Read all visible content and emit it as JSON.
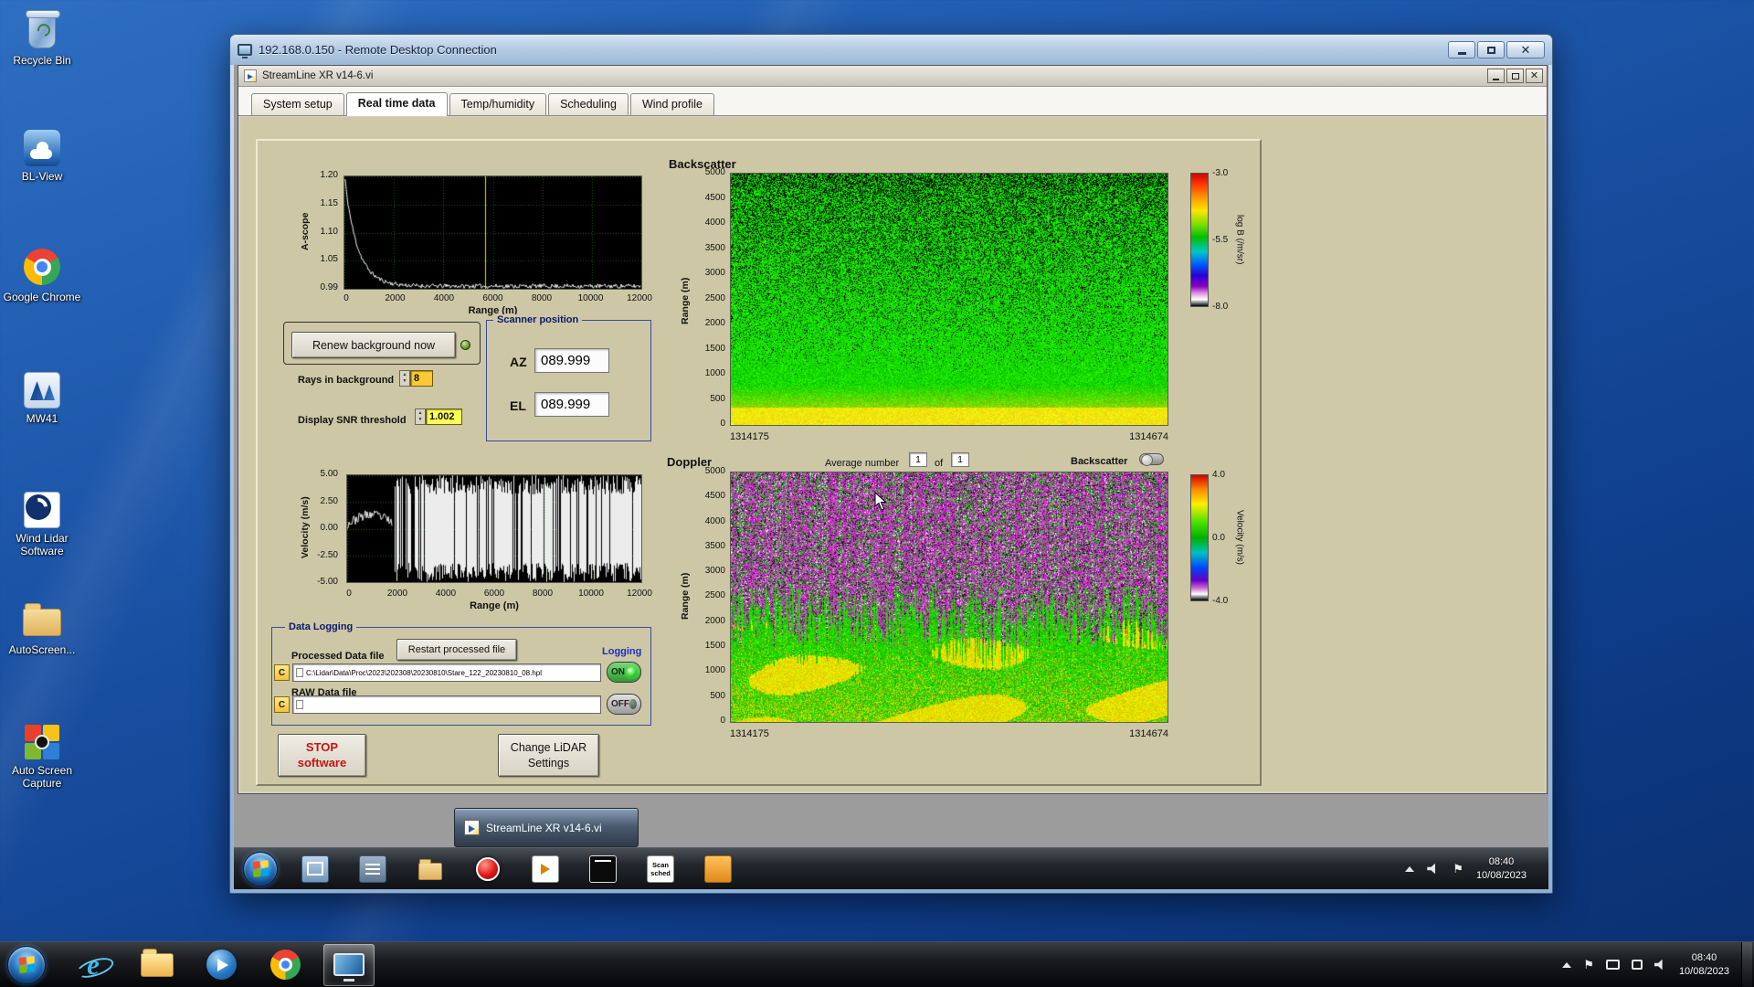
{
  "desktop": {
    "icons": [
      {
        "label": "Recycle Bin"
      },
      {
        "label": "BL-View"
      },
      {
        "label": "Google Chrome"
      },
      {
        "label": "MW41"
      },
      {
        "label": "Wind Lidar Software"
      },
      {
        "label": "AutoScreen..."
      },
      {
        "label": "Auto Screen Capture"
      }
    ]
  },
  "rdp": {
    "title": "192.168.0.150 - Remote Desktop Connection"
  },
  "app": {
    "title": "StreamLine XR v14-6.vi",
    "tabs": [
      "System setup",
      "Real time data",
      "Temp/humidity",
      "Scheduling",
      "Wind profile"
    ],
    "active_tab": "Real time data"
  },
  "ascope": {
    "ylabel": "A-scope",
    "xlabel": "Range (m)",
    "yticks": [
      "1.20",
      "1.15",
      "1.10",
      "1.05",
      "0.99"
    ],
    "xticks": [
      "0",
      "2000",
      "4000",
      "6000",
      "8000",
      "10000",
      "12000"
    ]
  },
  "background_controls": {
    "renew_button": "Renew background now",
    "rays_label": "Rays in background",
    "rays_value": "8",
    "snr_label": "Display SNR threshold",
    "snr_value": "1.002"
  },
  "scanner": {
    "title": "Scanner position",
    "az_label": "AZ",
    "az_value": "089.999",
    "el_label": "EL",
    "el_value": "089.999"
  },
  "backscatter": {
    "title": "Backscatter",
    "ylabel": "Range (m)",
    "yticks": [
      "5000",
      "4500",
      "4000",
      "3500",
      "3000",
      "2500",
      "2000",
      "1500",
      "1000",
      "500",
      "0"
    ],
    "x_start": "1314175",
    "x_end": "1314674",
    "colorbar_ticks": [
      "-3.0",
      "-5.5",
      "-8.0"
    ],
    "colorbar_label": "log B (/m/sr)"
  },
  "doppler": {
    "title": "Doppler",
    "avg_label": "Average number",
    "avg_value": "1",
    "of_label": "of",
    "of_value": "1",
    "toggle_label": "Backscatter",
    "ylabel": "Range (m)",
    "yticks": [
      "5000",
      "4500",
      "4000",
      "3500",
      "3000",
      "2500",
      "2000",
      "1500",
      "1000",
      "500",
      "0"
    ],
    "x_start": "1314175",
    "x_end": "1314674",
    "colorbar_ticks": [
      "4.0",
      "0.0",
      "-4.0"
    ],
    "colorbar_label": "Velocity (m/s)"
  },
  "velocity": {
    "ylabel": "Velocity (m/s)",
    "xlabel": "Range (m)",
    "yticks": [
      "5.00",
      "2.50",
      "0.00",
      "-2.50",
      "-5.00"
    ],
    "xticks": [
      "0",
      "2000",
      "4000",
      "6000",
      "8000",
      "10000",
      "12000"
    ]
  },
  "logging": {
    "title": "Data Logging",
    "processed_label": "Processed Data file",
    "restart_button": "Restart processed file",
    "logging_label": "Logging",
    "drive_label": "C",
    "processed_path": "C:\\Lidar\\Data\\Proc\\2023\\202308\\20230810\\Stare_122_20230810_08.hpl",
    "processed_toggle": "ON",
    "raw_label": "RAW Data file",
    "raw_path": "",
    "raw_toggle": "OFF"
  },
  "actions": {
    "stop_line1": "STOP",
    "stop_line2": "software",
    "settings_line1": "Change LiDAR",
    "settings_line2": "Settings"
  },
  "remote_taskbar": {
    "window_button": "StreamLine XR v14-6.vi",
    "scan_line1": "Scan",
    "scan_line2": "sched",
    "time": "08:40",
    "date": "10/08/2023"
  },
  "taskbar": {
    "time": "08:40",
    "date": "10/08/2023"
  },
  "chart_data": [
    {
      "type": "line",
      "title": "A-scope",
      "xlabel": "Range (m)",
      "ylabel": "A-scope",
      "xlim": [
        0,
        12000
      ],
      "ylim": [
        0.99,
        1.2
      ],
      "annotations": "white trace starts near 1.20 and decays exponentially to ~1.00 by 2000 m, then flat noisy near 0.99-1.00; yellow cursor line near 5800 m",
      "grid": true
    },
    {
      "type": "heatmap",
      "title": "Backscatter",
      "ylabel": "Range (m)",
      "y_range": [
        0,
        5000
      ],
      "x_range": [
        1314175,
        1314674
      ],
      "colorbar_label": "log B (/m/sr)",
      "colorbar_range": [
        -3.0,
        -8.0
      ],
      "annotations": "bright green field with black speckle density increasing with altitude; solid yellow band below ~500 m"
    },
    {
      "type": "line",
      "title": "Velocity",
      "xlabel": "Range (m)",
      "ylabel": "Velocity (m/s)",
      "xlim": [
        0,
        12000
      ],
      "ylim": [
        -5.0,
        5.0
      ],
      "annotations": "coherent trace near 0 m/s below ~2000 m, full-scale random noise beyond",
      "grid": true
    },
    {
      "type": "heatmap",
      "title": "Doppler",
      "ylabel": "Range (m)",
      "y_range": [
        0,
        5000
      ],
      "x_range": [
        1314175,
        1314674
      ],
      "colorbar_label": "Velocity (m/s)",
      "colorbar_range": [
        4.0,
        -4.0
      ],
      "annotations": "noisy magenta/white/green speckle alo ft with vertical streaks; coherent green with yellow patches below ~1500 m"
    }
  ]
}
